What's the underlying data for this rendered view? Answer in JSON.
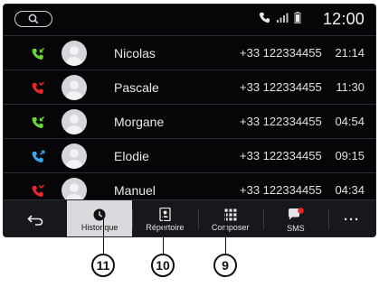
{
  "status": {
    "time": "12:00"
  },
  "calls": [
    {
      "name": "Nicolas",
      "number": "+33 122334455",
      "time": "21:14",
      "type": "received",
      "color": "#6ad43a"
    },
    {
      "name": "Pascale",
      "number": "+33 122334455",
      "time": "11:30",
      "type": "missed",
      "color": "#e8262b"
    },
    {
      "name": "Morgane",
      "number": "+33 122334455",
      "time": "04:54",
      "type": "received",
      "color": "#6ad43a"
    },
    {
      "name": "Elodie",
      "number": "+33 122334455",
      "time": "09:15",
      "type": "outgoing",
      "color": "#3aa7e8"
    },
    {
      "name": "Manuel",
      "number": "+33 122334455",
      "time": "04:34",
      "type": "missed",
      "color": "#e8262b"
    }
  ],
  "tabs": {
    "back": {
      "icon": "back-arrow-icon"
    },
    "history": {
      "label": "Historique",
      "icon": "clock-icon"
    },
    "contacts": {
      "label": "Répertoire",
      "icon": "contacts-book-icon"
    },
    "dialer": {
      "label": "Composer",
      "icon": "keypad-icon"
    },
    "sms": {
      "label": "SMS",
      "icon": "message-bubble-icon",
      "badge_color": "#e8262b"
    },
    "more": {
      "label": "···"
    }
  },
  "callouts": {
    "history": "11",
    "contacts": "10",
    "dialer": "9"
  },
  "colors": {
    "screen_bg": "#060608",
    "tabbar_bg": "#17181c",
    "active_tab_bg": "#d8dadd"
  }
}
